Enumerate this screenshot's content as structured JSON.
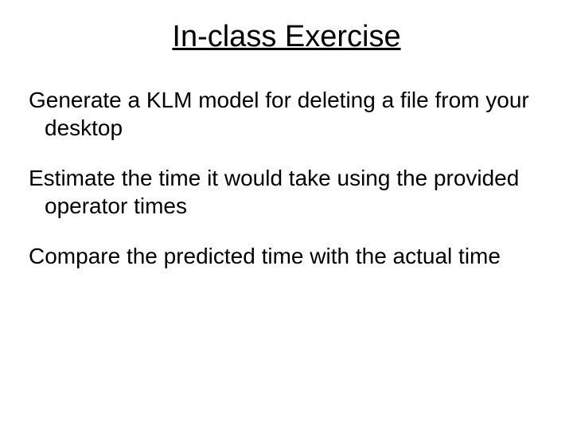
{
  "title": "In-class Exercise",
  "paragraphs": {
    "p1": "Generate a KLM model for deleting a file from your desktop",
    "p2": "Estimate the time it would take using the provided operator times",
    "p3": "Compare the predicted time with the actual time"
  }
}
